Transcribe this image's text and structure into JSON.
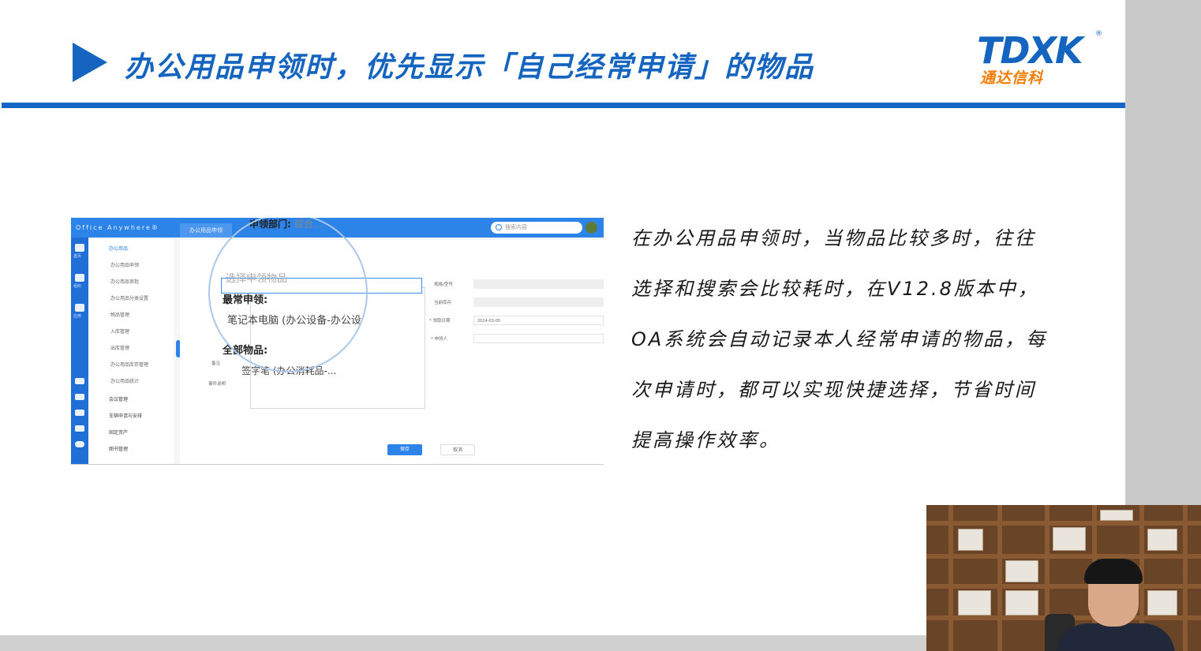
{
  "slide": {
    "title": "办公用品申领时，优先显示「自己经常申请」的物品",
    "logo": {
      "main": "TDXK",
      "sub": "通达信科",
      "reg": "®"
    },
    "description": [
      "在办公用品申领时，当物品比较多时，往往",
      "选择和搜索会比较耗时，在V12.8版本中，",
      "OA系统会自动记录本人经常申请的物品，每",
      "次申请时，都可以实现快捷选择，节省时间",
      "提高操作效率。"
    ]
  },
  "screenshot": {
    "brand": "Office Anywhere®",
    "tab": "办公用品申领",
    "search_placeholder": "搜索内容",
    "menu_header": "办公用品",
    "menu_items": [
      "办公用品申领",
      "办公用品审批",
      "办公用品分类设置",
      "物品管理",
      "入库管理",
      "出库管理",
      "办公用品库存管理",
      "办公用品统计"
    ],
    "menu_groups": [
      "会议管理",
      "车辆申请与安排",
      "固定资产",
      "图书管理"
    ],
    "rail_labels": [
      "首页",
      "组织",
      "应用"
    ],
    "dept_label": "申领部门:",
    "dept_value": "综合...",
    "item_placeholder": "选择申领物品",
    "common_label": "最常申领:",
    "common_item": "笔记本电脑 (办公设备-办公设",
    "all_label": "全部物品:",
    "all_item": "签字笔 (办公消耗品-...",
    "right_labels": [
      "规格/型号",
      "当前库存",
      "* 领取日期",
      "* 申领人"
    ],
    "date_value": "2024-03-05",
    "left_labels": [
      "备注",
      "事件说明"
    ],
    "save_label": "保存",
    "cancel_label": "取消"
  },
  "colors": {
    "brand_blue": "#1565c0",
    "logo_orange": "#f57c00",
    "app_blue": "#2d84e8"
  }
}
